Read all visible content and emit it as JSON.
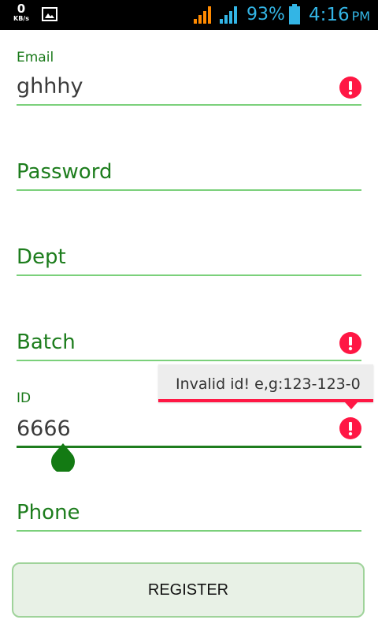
{
  "status_bar": {
    "data_speed_value": "0",
    "data_speed_unit": "KB/s",
    "battery_percent": "93%",
    "time": "4:16",
    "ampm": "PM",
    "accent_color": "#33b5e5",
    "signal_color_1": "#ff8a00",
    "signal_color_2": "#33b5e5"
  },
  "form": {
    "email": {
      "label": "Email",
      "value": "ghhhy",
      "has_error": true
    },
    "password": {
      "hint": "Password"
    },
    "dept": {
      "hint": "Dept"
    },
    "batch": {
      "hint": "Batch",
      "has_error": true
    },
    "id": {
      "label": "ID",
      "value": "6666",
      "has_error": true,
      "error_message": "Invalid id! e,g:123-123-0"
    },
    "phone": {
      "hint": "Phone"
    }
  },
  "register_button": {
    "label": "REGISTER"
  },
  "colors": {
    "primary_green": "#1e7d1e",
    "underline_green": "#7bd07b",
    "error_red": "#ff1744",
    "button_bg": "#e8f1e6"
  }
}
